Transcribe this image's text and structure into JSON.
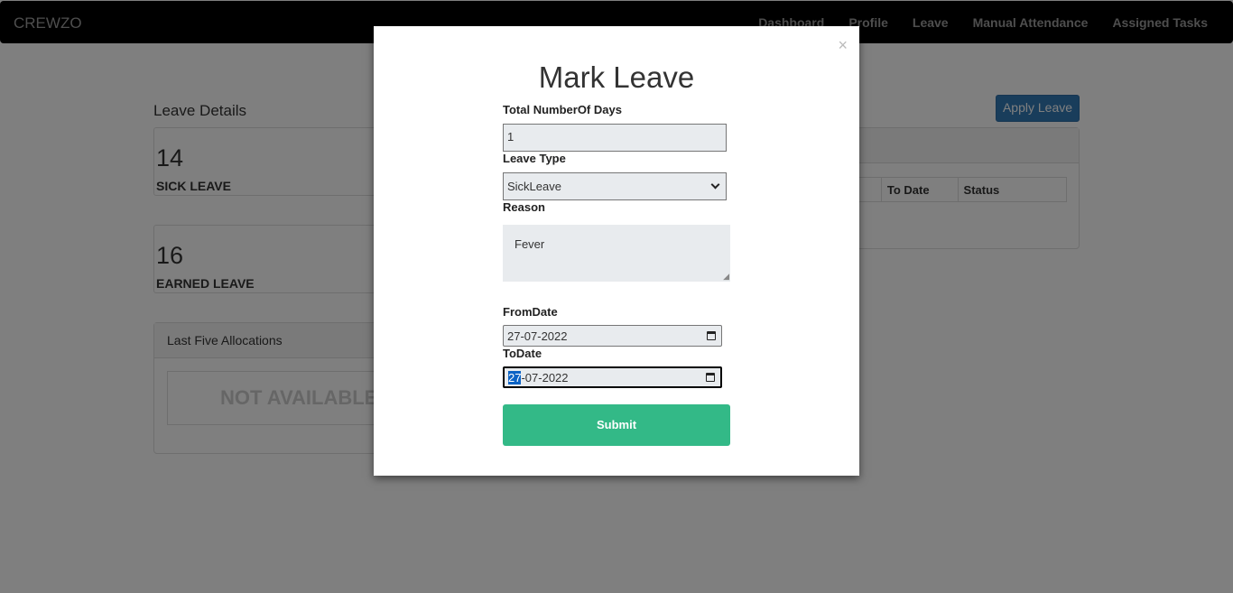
{
  "navbar": {
    "brand": "CREWZO",
    "links": [
      "Dashboard",
      "Profile",
      "Leave",
      "Manual Attendance",
      "Assigned Tasks"
    ]
  },
  "page": {
    "section_title": "Leave Details",
    "apply_button": "Apply Leave",
    "sick_leave": {
      "count": "14",
      "label": "SICK LEAVE"
    },
    "earned_leave": {
      "count": "16",
      "label": "EARNED LEAVE"
    },
    "allocations": {
      "title": "Last Five Allocations",
      "empty_text": "NOT AVAILABLE"
    },
    "table_headers": [
      "To Date",
      "Status"
    ]
  },
  "modal": {
    "title": "Mark Leave",
    "close_symbol": "×",
    "total_days_label": "Total NumberOf Days",
    "total_days_value": "1",
    "leave_type_label": "Leave Type",
    "leave_type_value": "SickLeave",
    "reason_label": "Reason",
    "reason_value": "Fever",
    "from_date_label": "FromDate",
    "from_date_value": "27-07-2022",
    "to_date_label": "ToDate",
    "to_date_day": "27",
    "to_date_rest": "-07-2022",
    "submit_label": "Submit"
  },
  "colors": {
    "navbar_bg": "#000000",
    "apply_button": "#337ab7",
    "submit_button": "#33b987",
    "overlay": "rgba(0,0,0,0.5)"
  }
}
